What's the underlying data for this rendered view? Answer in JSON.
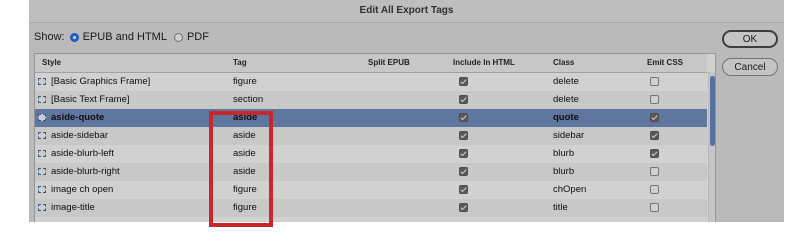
{
  "dialog": {
    "title": "Edit All Export Tags"
  },
  "show": {
    "label": "Show:",
    "options": [
      {
        "label": "EPUB and HTML",
        "selected": true
      },
      {
        "label": "PDF",
        "selected": false
      }
    ]
  },
  "buttons": {
    "ok": "OK",
    "cancel": "Cancel"
  },
  "table": {
    "columns": [
      "Style",
      "Tag",
      "Split EPUB",
      "Include In HTML",
      "Class",
      "Emit CSS"
    ],
    "rows": [
      {
        "style": "[Basic Graphics Frame]",
        "tag": "figure",
        "include_html": true,
        "class": "delete",
        "emit_css": false
      },
      {
        "style": "[Basic Text Frame]",
        "tag": "section",
        "include_html": true,
        "class": "delete",
        "emit_css": false
      },
      {
        "style": "aside-quote",
        "tag": "aside",
        "include_html": true,
        "class": "quote",
        "emit_css": true,
        "selected": true
      },
      {
        "style": "aside-sidebar",
        "tag": "aside",
        "include_html": true,
        "class": "sidebar",
        "emit_css": true
      },
      {
        "style": "aside-blurb-left",
        "tag": "aside",
        "include_html": true,
        "class": "blurb",
        "emit_css": true
      },
      {
        "style": "aside-blurb-right",
        "tag": "aside",
        "include_html": true,
        "class": "blurb",
        "emit_css": false
      },
      {
        "style": "image ch open",
        "tag": "figure",
        "include_html": true,
        "class": "chOpen",
        "emit_css": false
      },
      {
        "style": "image-title",
        "tag": "figure",
        "include_html": true,
        "class": "title",
        "emit_css": false
      }
    ]
  },
  "annotation": {
    "highlight_color": "#c9272b"
  }
}
